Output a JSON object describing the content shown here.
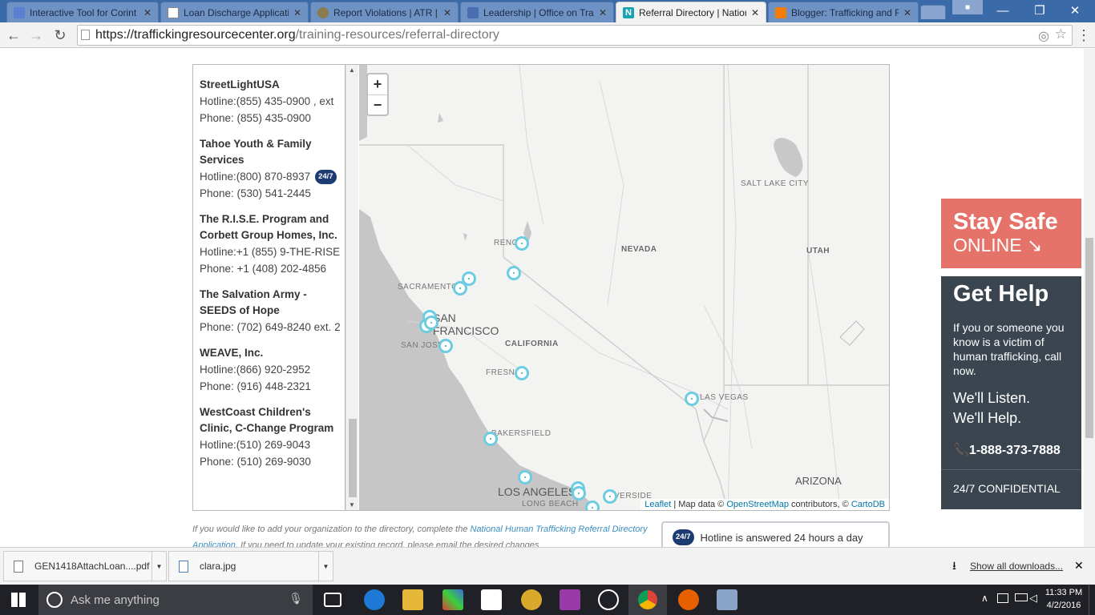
{
  "browser": {
    "tabs": [
      {
        "title": "Interactive Tool for Corint",
        "icon": "document-icon"
      },
      {
        "title": "Loan Discharge Applicatio",
        "icon": "page-icon"
      },
      {
        "title": "Report Violations | ATR | D",
        "icon": "seal-icon"
      },
      {
        "title": "Leadership | Office on Tra",
        "icon": "leaf-icon"
      },
      {
        "title": "Referral Directory | Nation",
        "icon": "n-logo-icon",
        "active": true
      },
      {
        "title": "Blogger: Trafficking and R",
        "icon": "blogger-icon"
      }
    ],
    "url_domain": "https://traffickingresourcecenter.org",
    "url_path": "/training-resources/referral-directory"
  },
  "directory": {
    "entries": [
      {
        "name": "StreetLightUSA",
        "lines": [
          {
            "text": "Hotline:(855) 435-0900 , ext"
          },
          {
            "text": "Phone: (855) 435-0900"
          }
        ]
      },
      {
        "name": "Tahoe Youth & Family Services",
        "lines": [
          {
            "text": "Hotline:(800) 870-8937",
            "badge": "24/7"
          },
          {
            "text": "Phone: (530) 541-2445"
          }
        ]
      },
      {
        "name": "The R.I.S.E. Program and Corbett Group Homes, Inc.",
        "lines": [
          {
            "text": "Hotline:+1 (855) 9-THE-RISE"
          },
          {
            "text": "Phone: +1 (408) 202-4856"
          }
        ]
      },
      {
        "name": "The Salvation Army - SEEDS of Hope",
        "lines": [
          {
            "text": "Phone: (702) 649-8240 ext. 2"
          }
        ]
      },
      {
        "name": "WEAVE, Inc.",
        "lines": [
          {
            "text": "Hotline:(866) 920-2952"
          },
          {
            "text": "Phone: (916) 448-2321"
          }
        ]
      },
      {
        "name": "WestCoast Children's Clinic, C-Change Program",
        "lines": [
          {
            "text": "Hotline:(510) 269-9043"
          },
          {
            "text": "Phone: (510) 269-9030"
          }
        ]
      }
    ]
  },
  "map": {
    "zoom_in": "+",
    "zoom_out": "−",
    "labels": {
      "salt_lake": "SALT LAKE CITY",
      "nevada": "NEVADA",
      "utah": "UTAH",
      "reno": "RENO",
      "sacramento": "SACRAMENTO",
      "san_francisco": "SAN FRANCISCO",
      "san_jose": "SAN JOSE",
      "california": "CALIFORNIA",
      "fresno": "FRESNO",
      "las_vegas": "LAS VEGAS",
      "bakersfield": "BAKERSFIELD",
      "los_angeles": "LOS ANGELES",
      "long_beach": "LONG BEACH",
      "riverside": "RIVERSIDE",
      "arizona": "ARIZONA"
    },
    "attribution": {
      "leaflet": "Leaflet",
      "mid": " | Map data © ",
      "osm": "OpenStreetMap",
      "contrib": " contributors, © ",
      "carto": "CartoDB"
    }
  },
  "note": {
    "pre": "If you would like to add your organization to the directory, complete the ",
    "link": "National Human Trafficking Referral Directory Application",
    "post": ". If you need to update your existing record, please email the desired changes"
  },
  "hotline_box": {
    "badge": "24/7",
    "text": "Hotline is answered 24 hours a day"
  },
  "stay_safe": {
    "line1": "Stay Safe",
    "line2": "ONLINE ↘"
  },
  "get_help": {
    "title": "Get Help",
    "desc": "If you or someone you know is a victim of human trafficking, call now.",
    "listen1": "We'll Listen.",
    "listen2": "We'll Help.",
    "phone": "1-888-373-7888",
    "confidential": "24/7 CONFIDENTIAL"
  },
  "downloads": {
    "items": [
      {
        "name": "GEN1418AttachLoan....pdf"
      },
      {
        "name": "clara.jpg"
      }
    ],
    "show_all": "Show all downloads..."
  },
  "taskbar": {
    "search": "Ask me anything",
    "time": "11:33 PM",
    "date": "4/2/2016"
  },
  "colors": {
    "accent_tab": "#3b6aa8",
    "marker": "#6ccde0",
    "stay_safe": "#e5736a",
    "get_help": "#3b4550",
    "badge": "#1c3b73"
  }
}
